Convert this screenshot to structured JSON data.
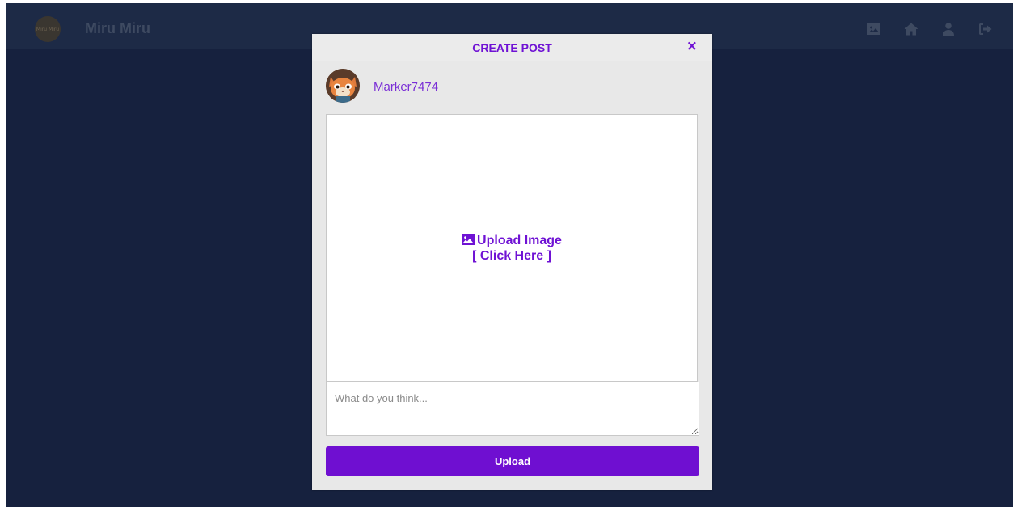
{
  "navbar": {
    "logo_text": "Miru Miru",
    "brand": "Miru Miru",
    "icons": [
      "image-icon",
      "home-icon",
      "user-icon",
      "logout-icon"
    ]
  },
  "modal": {
    "title": "CREATE POST",
    "close_label": "×",
    "username": "Marker7474",
    "upload_label": "Upload Image",
    "upload_hint": "[ Click Here ]",
    "caption_placeholder": "What do you think...",
    "submit_label": "Upload"
  },
  "colors": {
    "accent": "#6f12d4",
    "page_bg": "#16213e",
    "navbar_bg": "#1d2a46"
  }
}
